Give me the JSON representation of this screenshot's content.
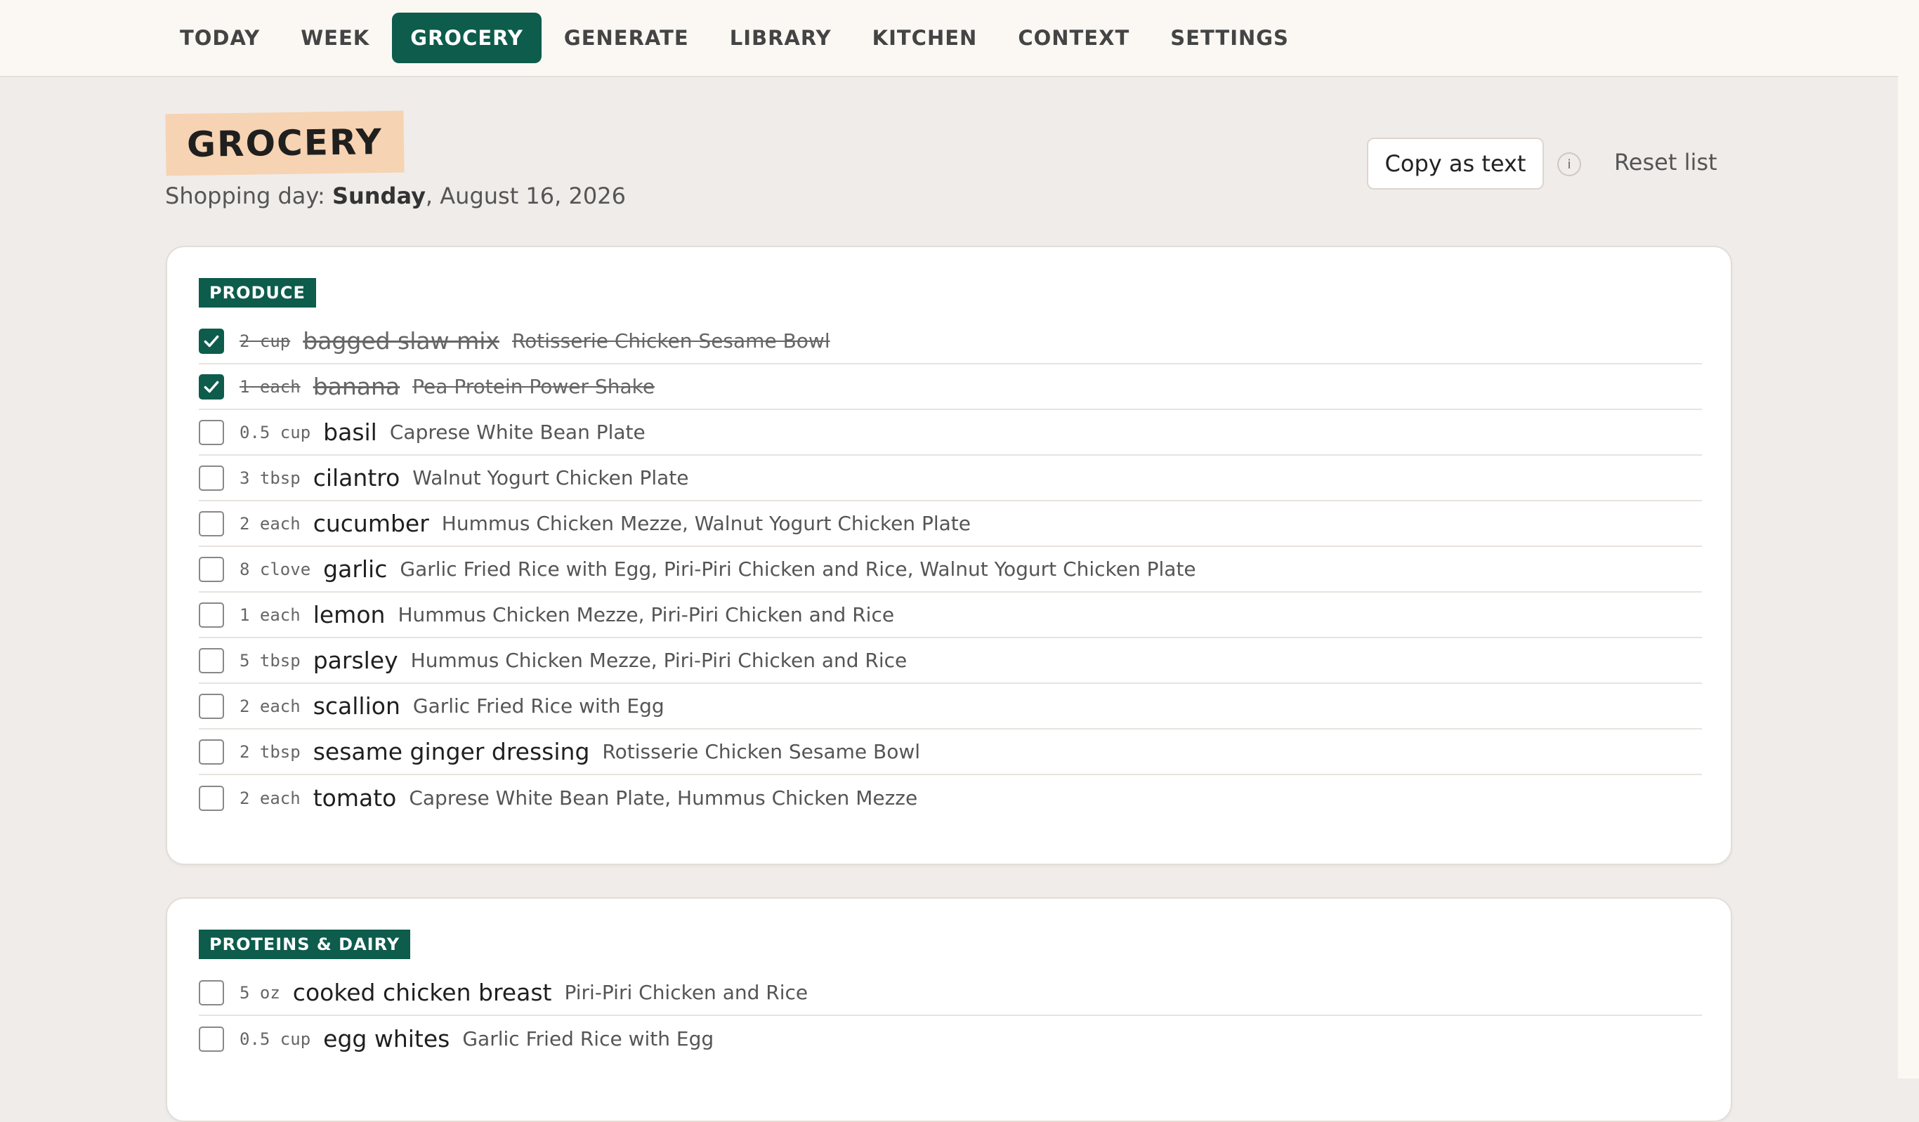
{
  "nav": {
    "tabs": [
      {
        "label": "TODAY"
      },
      {
        "label": "WEEK"
      },
      {
        "label": "GROCERY",
        "active": true
      },
      {
        "label": "GENERATE"
      },
      {
        "label": "LIBRARY"
      },
      {
        "label": "KITCHEN"
      },
      {
        "label": "CONTEXT"
      },
      {
        "label": "SETTINGS"
      }
    ]
  },
  "header": {
    "title": "GROCERY",
    "shopping_prefix": "Shopping day: ",
    "shopping_day": "Sunday",
    "shopping_date": ", August 16, 2026",
    "copy_label": "Copy as text",
    "info_glyph": "i",
    "reset_label": "Reset list"
  },
  "colors": {
    "accent": "#0d5c4c",
    "title_highlight": "#f6d3b2",
    "background": "#f0ecea"
  },
  "sections": [
    {
      "title": "PRODUCE",
      "items": [
        {
          "qty": "2 cup",
          "name": "bagged slaw mix",
          "recipes": "Rotisserie Chicken Sesame Bowl",
          "checked": true
        },
        {
          "qty": "1 each",
          "name": "banana",
          "recipes": "Pea Protein Power Shake",
          "checked": true
        },
        {
          "qty": "0.5 cup",
          "name": "basil",
          "recipes": "Caprese White Bean Plate",
          "checked": false
        },
        {
          "qty": "3 tbsp",
          "name": "cilantro",
          "recipes": "Walnut Yogurt Chicken Plate",
          "checked": false
        },
        {
          "qty": "2 each",
          "name": "cucumber",
          "recipes": "Hummus Chicken Mezze, Walnut Yogurt Chicken Plate",
          "checked": false
        },
        {
          "qty": "8 clove",
          "name": "garlic",
          "recipes": "Garlic Fried Rice with Egg, Piri-Piri Chicken and Rice, Walnut Yogurt Chicken Plate",
          "checked": false
        },
        {
          "qty": "1 each",
          "name": "lemon",
          "recipes": "Hummus Chicken Mezze, Piri-Piri Chicken and Rice",
          "checked": false
        },
        {
          "qty": "5 tbsp",
          "name": "parsley",
          "recipes": "Hummus Chicken Mezze, Piri-Piri Chicken and Rice",
          "checked": false
        },
        {
          "qty": "2 each",
          "name": "scallion",
          "recipes": "Garlic Fried Rice with Egg",
          "checked": false
        },
        {
          "qty": "2 tbsp",
          "name": "sesame ginger dressing",
          "recipes": "Rotisserie Chicken Sesame Bowl",
          "checked": false
        },
        {
          "qty": "2 each",
          "name": "tomato",
          "recipes": "Caprese White Bean Plate, Hummus Chicken Mezze",
          "checked": false
        }
      ]
    },
    {
      "title": "PROTEINS & DAIRY",
      "items": [
        {
          "qty": "5 oz",
          "name": "cooked chicken breast",
          "recipes": "Piri-Piri Chicken and Rice",
          "checked": false
        },
        {
          "qty": "0.5 cup",
          "name": "egg whites",
          "recipes": "Garlic Fried Rice with Egg",
          "checked": false
        }
      ]
    }
  ]
}
